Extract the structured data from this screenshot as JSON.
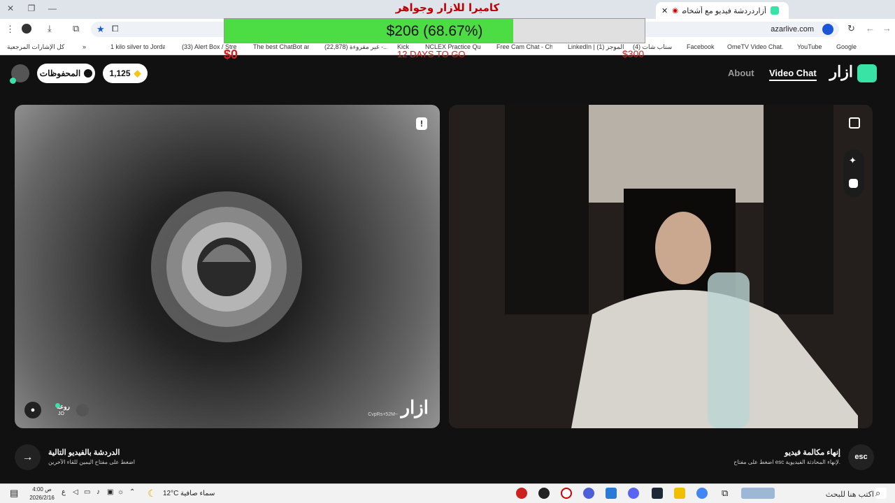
{
  "browser": {
    "tab_title": "أزاردردشة فيديو مع أشخاص",
    "url": "azarlive.com",
    "bookmarks": [
      {
        "label": "Google"
      },
      {
        "label": "YouTube"
      },
      {
        "label": "OmeTV Video Chat..."
      },
      {
        "label": "Facebook"
      },
      {
        "label": "(4) سناب شات"
      },
      {
        "label": "LinkedIn | (1) الموجز"
      },
      {
        "label": "Free Cam Chat - Ch..."
      },
      {
        "label": "NCLEX Practice Que..."
      },
      {
        "label": "Kick"
      },
      {
        "label": "(22,878) غير مقروءة -..."
      },
      {
        "label": "The best ChatBot an..."
      },
      {
        "label": "(33) Alert Box / Stre..."
      },
      {
        "label": "1 kilo silver to Jorda..."
      }
    ],
    "all_bookmarks_label": "كل الإشارات المرجعية"
  },
  "overlay": {
    "title": "كاميرا للازار وجواهر",
    "goal_text": "$206 (68.67%)",
    "goal_progress": 0.6867,
    "goal_min": "$0",
    "goal_days": "12 DAYS TO GO",
    "goal_max": "$300",
    "fill_color": "#4cdd45"
  },
  "app": {
    "logo": "ازار",
    "nav_video_chat": "Video Chat",
    "nav_about": "About",
    "gems": "1,125",
    "saved": "المحفوظات",
    "brand_color": "#39e3a6"
  },
  "left_panel": {
    "user_name": "روعه",
    "user_country": "JO",
    "watermark": "ازار",
    "watermark_id": "CvpRs+52M~"
  },
  "footer": {
    "next_title": "الدردشة بالفيديو التالية",
    "next_subtitle": "اضغط على مفتاح اليمين للقاء الآخرين",
    "end_title": "إنهاء مكالمة فيديو",
    "end_subtitle": "اضغط على مفتاح esc لإنهاء المحادثة الفيديوية.",
    "esc_label": "esc"
  },
  "taskbar": {
    "search_placeholder": "اكتب هنا للبحث",
    "weather_text": "سماء صافية",
    "temperature": "12°C",
    "time": "4:00 ص",
    "date": "2026/2/16",
    "lang": "ع"
  }
}
